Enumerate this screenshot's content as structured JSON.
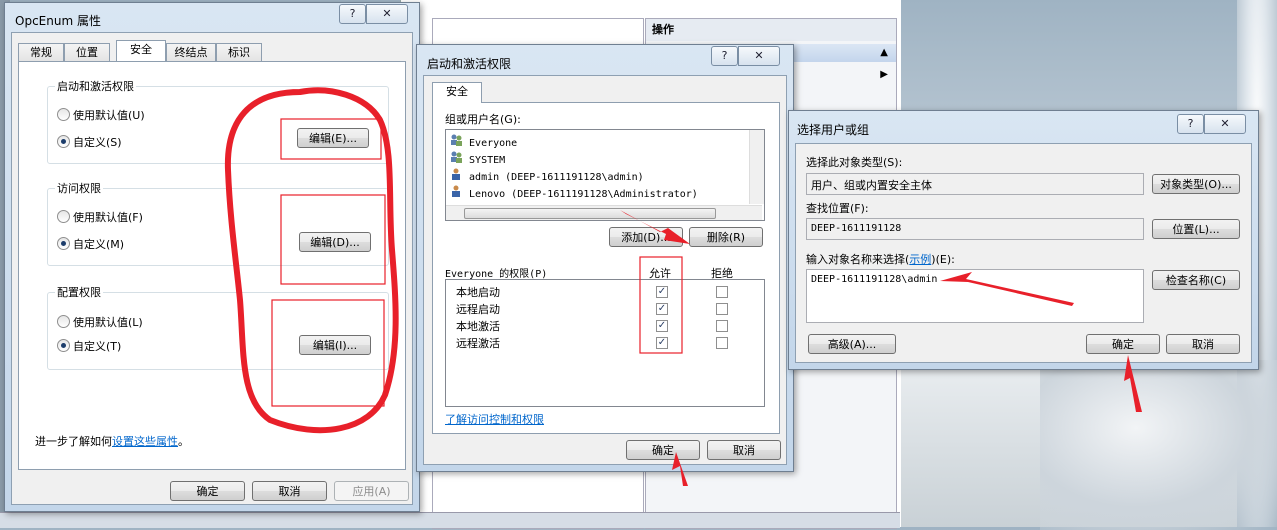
{
  "background": {
    "mmc_right_header": "操作"
  },
  "opcenum_dialog": {
    "title": "OpcEnum 属性",
    "help": "?",
    "close": "✕",
    "tabs": [
      "常规",
      "位置",
      "安全",
      "终结点",
      "标识"
    ],
    "active_tab": "安全",
    "groups": [
      {
        "title": "启动和激活权限",
        "radio_default": "使用默认值(U)",
        "radio_custom": "自定义(S)",
        "edit_button": "编辑(E)..."
      },
      {
        "title": "访问权限",
        "radio_default": "使用默认值(F)",
        "radio_custom": "自定义(M)",
        "edit_button": "编辑(D)..."
      },
      {
        "title": "配置权限",
        "radio_default": "使用默认值(L)",
        "radio_custom": "自定义(T)",
        "edit_button": "编辑(I)..."
      }
    ],
    "learn_more_prefix": "进一步了解如何",
    "learn_more_link": "设置这些属性",
    "learn_more_suffix": "。",
    "ok": "确定",
    "cancel": "取消",
    "apply": "应用(A)"
  },
  "launch_dialog": {
    "title": "启动和激活权限",
    "help": "?",
    "close": "✕",
    "tab": "安全",
    "group_users_label": "组或用户名(G):",
    "users": [
      "Everyone",
      "SYSTEM",
      "admin (DEEP-1611191128\\admin)",
      "Lenovo (DEEP-1611191128\\Administrator)"
    ],
    "add": "添加(D)...",
    "remove": "删除(R)",
    "perm_label": "Everyone 的权限(P)",
    "allow": "允许",
    "deny": "拒绝",
    "permissions": [
      {
        "name": "本地启动",
        "allow": true,
        "deny": false
      },
      {
        "name": "远程启动",
        "allow": true,
        "deny": false
      },
      {
        "name": "本地激活",
        "allow": true,
        "deny": false
      },
      {
        "name": "远程激活",
        "allow": true,
        "deny": false
      }
    ],
    "learn_link": "了解访问控制和权限",
    "ok": "确定",
    "cancel": "取消"
  },
  "select_dialog": {
    "title": "选择用户或组",
    "help": "?",
    "close": "✕",
    "obj_type_label": "选择此对象类型(S):",
    "obj_type_value": "用户、组或内置安全主体",
    "obj_type_btn": "对象类型(O)...",
    "location_label": "查找位置(F):",
    "location_value": "DEEP-1611191128",
    "location_btn": "位置(L)...",
    "enter_label_prefix": "输入对象名称来选择(",
    "enter_label_link": "示例",
    "enter_label_suffix": ")(E):",
    "enter_value": "DEEP-1611191128\\admin",
    "check_btn": "检查名称(C)",
    "advanced_btn": "高级(A)...",
    "ok": "确定",
    "cancel": "取消"
  },
  "annotation_color": "#e8202a"
}
